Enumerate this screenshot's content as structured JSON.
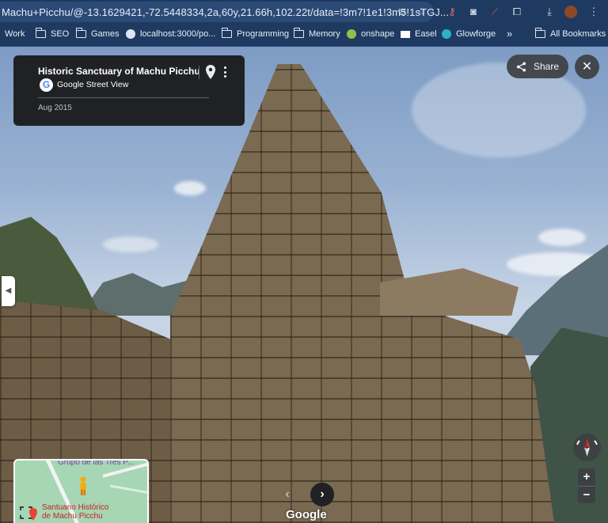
{
  "browser": {
    "url": "Machu+Picchu/@-13.1629421,-72.5448334,2a,60y,21.66h,102.22t/data=!3m7!1e1!3m5!1sTGJ...",
    "bookmarks": [
      {
        "label": "Work",
        "icon": "folder-icon"
      },
      {
        "label": "SEO",
        "icon": "folder-icon"
      },
      {
        "label": "Games",
        "icon": "folder-icon"
      },
      {
        "label": "localhost:3000/po...",
        "icon": "globe-icon"
      },
      {
        "label": "Programming",
        "icon": "folder-icon"
      },
      {
        "label": "Memory",
        "icon": "folder-icon"
      },
      {
        "label": "onshape",
        "icon": "onshape-icon"
      },
      {
        "label": "Easel",
        "icon": "easel-icon"
      },
      {
        "label": "Glowforge",
        "icon": "glowforge-icon"
      },
      {
        "label": "All Bookmarks",
        "icon": "folder-icon"
      }
    ],
    "overflow": "»"
  },
  "info_card": {
    "title": "Historic Sanctuary of Machu Picchu",
    "source": "Google Street View",
    "date": "Aug 2015"
  },
  "controls": {
    "share_label": "Share",
    "close": "✕",
    "zoom_in": "+",
    "zoom_out": "−",
    "prev": "‹",
    "next": "›"
  },
  "minimap": {
    "label_top": "Grupo de las Tres P...",
    "label_place_line1": "Santuario Histórico",
    "label_place_line2": "de Machu Picchu"
  },
  "watermark": "Google",
  "colors": {
    "chrome": "#1f3a60",
    "card": "#202124",
    "map_green": "#a6d6b4"
  }
}
